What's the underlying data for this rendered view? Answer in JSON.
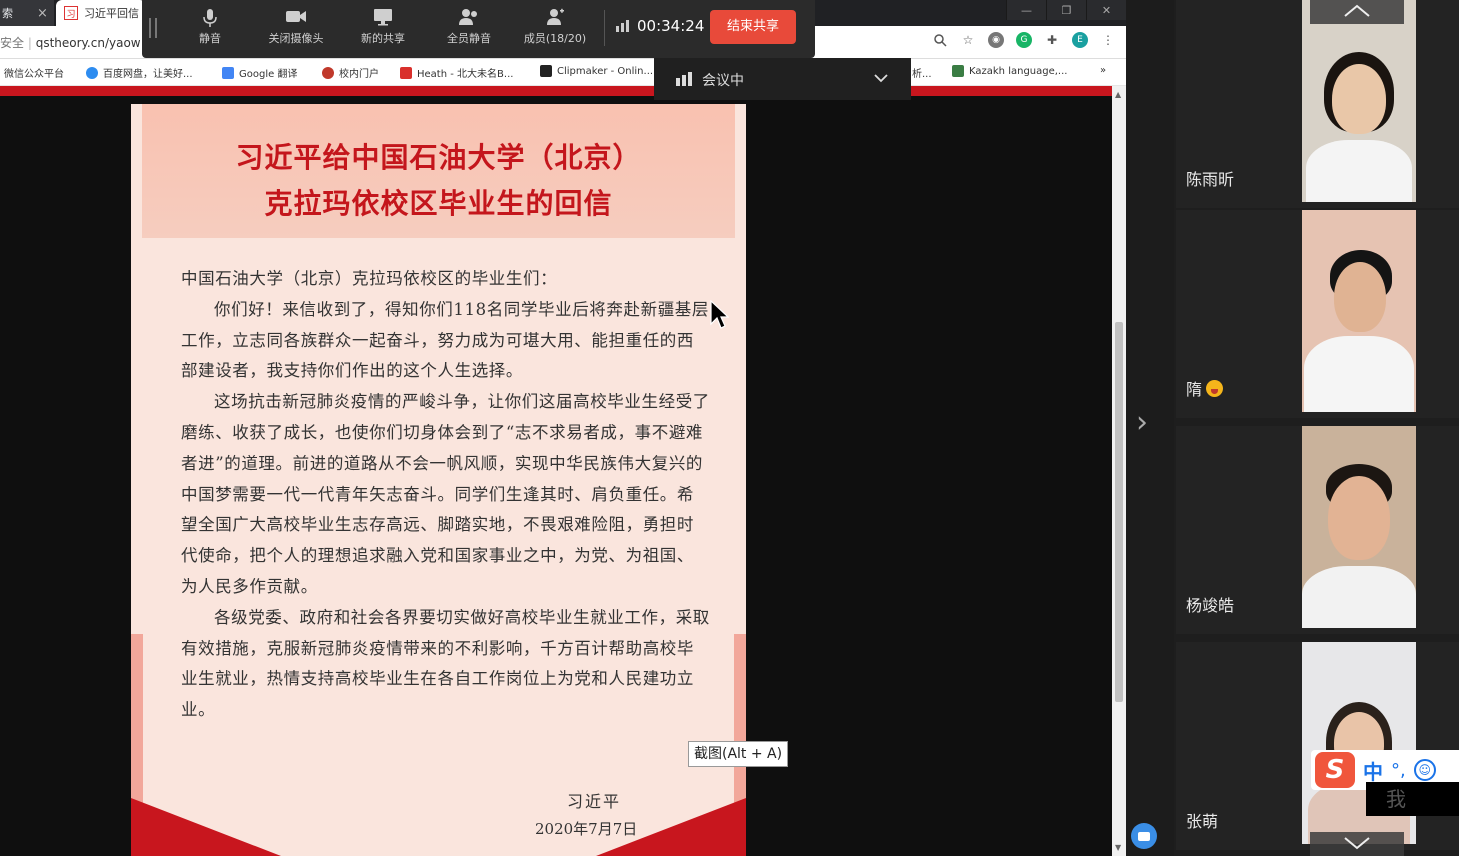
{
  "browser": {
    "tabs": [
      {
        "label": "索",
        "close": "×"
      },
      {
        "label": "习近平回信",
        "favicon": "习"
      }
    ],
    "window_controls": [
      "—",
      "❐",
      "✕"
    ],
    "address": {
      "security": "安全",
      "url": "qstheory.cn/yaow"
    },
    "bookmarks": [
      {
        "label": "微信公众平台",
        "color": "#07c160"
      },
      {
        "label": "百度网盘，让美好...",
        "color": "#2d8cf0"
      },
      {
        "label": "Google 翻译",
        "color": "#4285f4"
      },
      {
        "label": "校内门户",
        "color": "#c0392b"
      },
      {
        "label": "Heath - 北大未名B...",
        "color": "#d9302c"
      },
      {
        "label": "Clipmaker - Onlin...",
        "color": "#222222"
      },
      {
        "label": "析...",
        "color": "#999999"
      },
      {
        "label": "Kazakh language,...",
        "color": "#3a7d44"
      }
    ],
    "bookmarks_more": "»"
  },
  "meeting_toolbar": {
    "buttons": [
      {
        "label": "静音",
        "icon": "microphone-icon",
        "glyph": "🎙"
      },
      {
        "label": "关闭摄像头",
        "icon": "camera-icon",
        "glyph": "■"
      },
      {
        "label": "新的共享",
        "icon": "share-screen-icon",
        "glyph": "▣"
      },
      {
        "label": "全员静音",
        "icon": "mute-all-icon",
        "glyph": "♟"
      },
      {
        "label": "成员(18/20)",
        "icon": "members-icon",
        "glyph": "♙"
      }
    ],
    "timer": "00:34:24",
    "end_share": "结束共享",
    "status_pill": {
      "label": "会议中",
      "chevron": "⌄"
    }
  },
  "letter": {
    "title_line1": "习近平给中国石油大学（北京）",
    "title_line2": "克拉玛依校区毕业生的回信",
    "salutation": "中国石油大学（北京）克拉玛依校区的毕业生们：",
    "paragraphs": [
      "你们好！来信收到了，得知你们118名同学毕业后将奔赴新疆基层工作，立志同各族群众一起奋斗，努力成为可堪大用、能担重任的西部建设者，我支持你们作出的这个人生选择。",
      "这场抗击新冠肺炎疫情的严峻斗争，让你们这届高校毕业生经受了磨练、收获了成长，也使你们切身体会到了“志不求易者成，事不避难者进”的道理。前进的道路从不会一帆风顺，实现中华民族伟大复兴的中国梦需要一代一代青年矢志奋斗。同学们生逢其时、肩负重任。希望全国广大高校毕业生志存高远、脚踏实地，不畏艰难险阻，勇担时代使命，把个人的理想追求融入党和国家事业之中，为党、为祖国、为人民多作贡献。",
      "各级党委、政府和社会各界要切实做好高校毕业生就业工作，采取有效措施，克服新冠肺炎疫情带来的不利影响，千方百计帮助高校毕业生就业，热情支持高校毕业生在各自工作岗位上为党和人民建功立业。"
    ],
    "signature": "习近平",
    "date": "2020年7月7日"
  },
  "tooltip": "截图(Alt + A)",
  "participants": [
    {
      "name": "陈雨昕",
      "emoji": false,
      "bg": "#d8d2c8",
      "skin": "#e9c7a8",
      "hair": "#1a1410",
      "shirt": "#f4f4f4"
    },
    {
      "name": "隋",
      "emoji": true,
      "bg": "#e6c3b2",
      "skin": "#e0b393",
      "hair": "#141414",
      "shirt": "#f5f5f5"
    },
    {
      "name": "杨竣皓",
      "emoji": false,
      "bg": "#c9b29b",
      "skin": "#e2b394",
      "hair": "#1c1612",
      "shirt": "#f2f2f2"
    },
    {
      "name": "张萌",
      "emoji": false,
      "bg": "#e7e7e9",
      "skin": "#e9c4a8",
      "hair": "#2a211b",
      "shirt": "#e0c5b8"
    }
  ],
  "nav": {
    "up": "︿",
    "down": "﹀",
    "next": "›"
  },
  "ime": {
    "logo": "S",
    "lang": "中",
    "punct": "°,",
    "smile": "☺",
    "sub": "我"
  }
}
